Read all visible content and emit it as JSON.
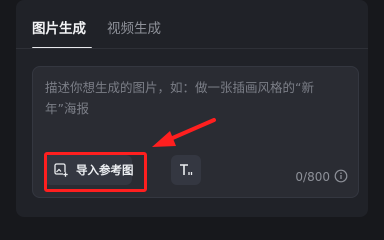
{
  "tabs": [
    {
      "label": "图片生成",
      "active": true
    },
    {
      "label": "视频生成",
      "active": false
    }
  ],
  "prompt": {
    "placeholder": "描述你想生成的图片，如：做一张插画风格的“新年”海报"
  },
  "toolbar": {
    "reference_image_label": "导入参考图",
    "reference_image_icon": "image-upload-icon",
    "text_style_icon": "text-format-icon"
  },
  "counter": {
    "text": "0/800"
  },
  "annotation": {
    "color": "#ff1f1f"
  },
  "colors": {
    "panel": "#202228",
    "input": "#2a2c33",
    "button": "#343741"
  }
}
